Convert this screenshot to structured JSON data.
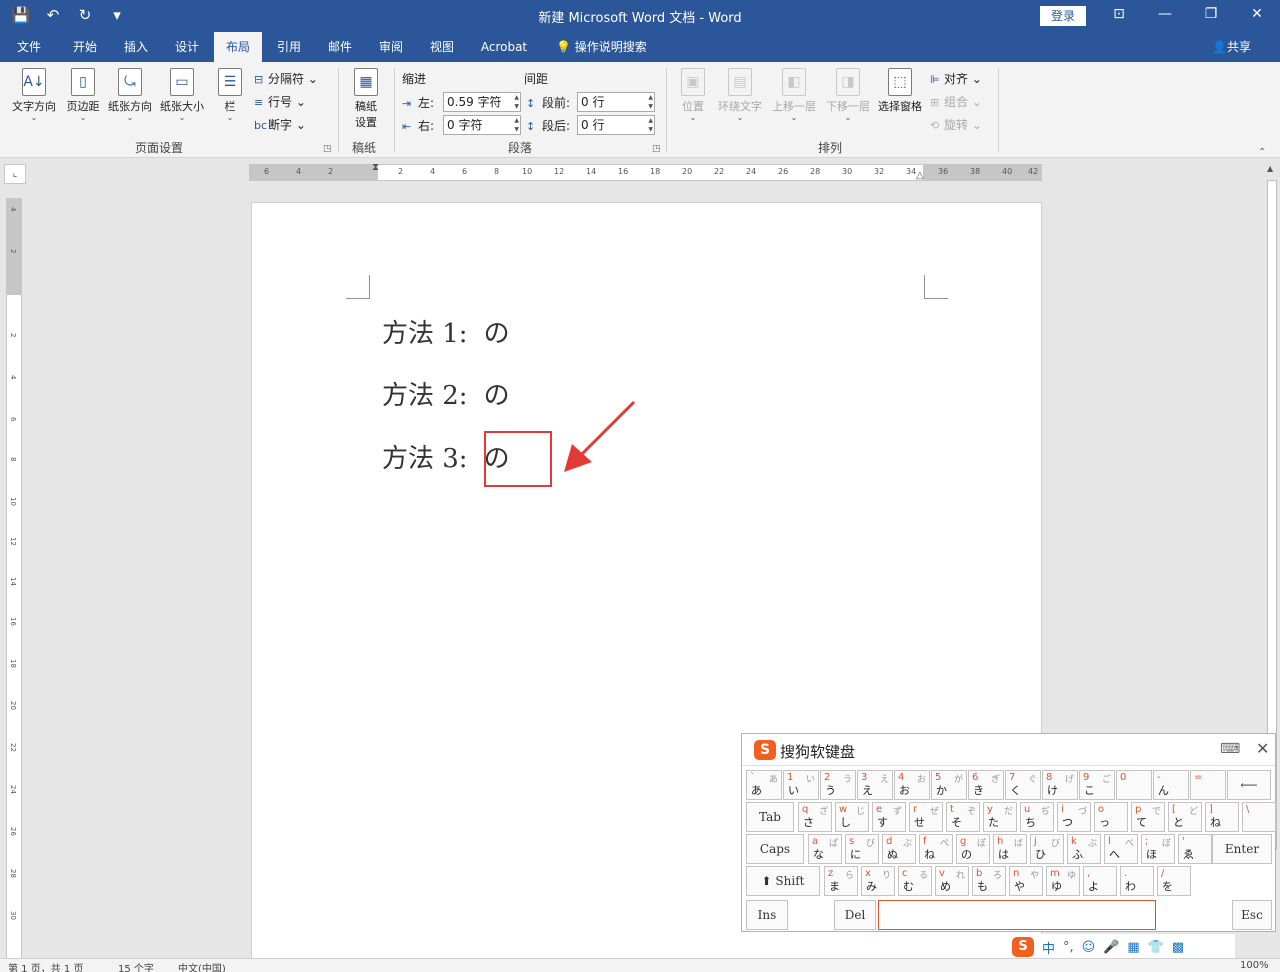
{
  "titlebar": {
    "title": "新建 Microsoft Word 文档 - Word",
    "login": "登录",
    "qat": [
      "💾",
      "↶",
      "↻",
      "▾"
    ]
  },
  "tabs": [
    "文件",
    "开始",
    "插入",
    "设计",
    "布局",
    "引用",
    "邮件",
    "审阅",
    "视图",
    "Acrobat"
  ],
  "tab_search": "操作说明搜索",
  "share": "共享",
  "ribbon": {
    "page_setup": {
      "text_direction": "文字方向",
      "margins": "页边距",
      "orientation": "纸张方向",
      "size": "纸张大小",
      "columns": "栏",
      "breaks": "分隔符",
      "line_numbers": "行号",
      "hyphenation": "断字",
      "group_label": "页面设置"
    },
    "manuscript": {
      "btn_line1": "稿纸",
      "btn_line2": "设置",
      "group_label": "稿纸"
    },
    "paragraph": {
      "indent_label": "缩进",
      "spacing_label": "间距",
      "left_label": "左:",
      "left_value": "0.59 字符",
      "right_label": "右:",
      "right_value": "0 字符",
      "before_label": "段前:",
      "before_value": "0 行",
      "after_label": "段后:",
      "after_value": "0 行",
      "group_label": "段落"
    },
    "arrange": {
      "position": "位置",
      "wrap_text": "环绕文字",
      "bring_forward": "上移一层",
      "send_backward": "下移一层",
      "selection_pane": "选择窗格",
      "align": "对齐",
      "group": "组合",
      "rotate": "旋转",
      "group_label": "排列"
    }
  },
  "ruler": {
    "h_ticks": [
      "6",
      "4",
      "2",
      "2",
      "4",
      "6",
      "8",
      "10",
      "12",
      "14",
      "16",
      "18",
      "20",
      "22",
      "24",
      "26",
      "28",
      "30",
      "32",
      "34",
      "36",
      "38",
      "40",
      "42"
    ],
    "v_ticks": [
      "4",
      "2",
      "2",
      "4",
      "6",
      "8",
      "10",
      "12",
      "14",
      "16",
      "18",
      "20",
      "22",
      "24",
      "26",
      "28",
      "30"
    ]
  },
  "document": {
    "lines": [
      {
        "label": "方法 1:",
        "char": "の"
      },
      {
        "label": "方法 2:",
        "char": "の"
      },
      {
        "label": "方法 3:",
        "char": "の"
      }
    ]
  },
  "keyboard": {
    "title": "搜狗软键盘",
    "row1": [
      {
        "tl": "`",
        "tr": "あ",
        "bl": "あ"
      },
      {
        "tl": "1",
        "tr": "い",
        "bl": "い"
      },
      {
        "tl": "2",
        "tr": "う",
        "bl": "う"
      },
      {
        "tl": "3",
        "tr": "え",
        "bl": "え"
      },
      {
        "tl": "4",
        "tr": "お",
        "bl": "お"
      },
      {
        "tl": "5",
        "tr": "が",
        "bl": "か"
      },
      {
        "tl": "6",
        "tr": "ぎ",
        "bl": "き"
      },
      {
        "tl": "7",
        "tr": "ぐ",
        "bl": "く"
      },
      {
        "tl": "8",
        "tr": "げ",
        "bl": "け"
      },
      {
        "tl": "9",
        "tr": "ご",
        "bl": "こ"
      },
      {
        "tl": "0",
        "tr": "",
        "bl": ""
      },
      {
        "tl": "-",
        "tr": "",
        "bl": "ん"
      },
      {
        "tl": "=",
        "tr": "",
        "bl": ""
      }
    ],
    "backspace": "⟵",
    "tab": "Tab",
    "row2": [
      {
        "tl": "q",
        "tr": "ざ",
        "bl": "さ"
      },
      {
        "tl": "w",
        "tr": "じ",
        "bl": "し"
      },
      {
        "tl": "e",
        "tr": "ず",
        "bl": "す"
      },
      {
        "tl": "r",
        "tr": "ぜ",
        "bl": "せ"
      },
      {
        "tl": "t",
        "tr": "ぞ",
        "bl": "そ"
      },
      {
        "tl": "y",
        "tr": "だ",
        "bl": "た"
      },
      {
        "tl": "u",
        "tr": "ぢ",
        "bl": "ち"
      },
      {
        "tl": "i",
        "tr": "づ",
        "bl": "つ"
      },
      {
        "tl": "o",
        "tr": "",
        "bl": "っ"
      },
      {
        "tl": "p",
        "tr": "で",
        "bl": "て"
      },
      {
        "tl": "[",
        "tr": "ど",
        "bl": "と"
      },
      {
        "tl": "]",
        "tr": "",
        "bl": "ね"
      },
      {
        "tl": "\\",
        "tr": "",
        "bl": ""
      }
    ],
    "caps": "Caps",
    "row3": [
      {
        "tl": "a",
        "tr": "ぱ",
        "bl": "な"
      },
      {
        "tl": "s",
        "tr": "び",
        "bl": "に"
      },
      {
        "tl": "d",
        "tr": "ぷ",
        "bl": "ぬ"
      },
      {
        "tl": "f",
        "tr": "ぺ",
        "bl": "ね"
      },
      {
        "tl": "g",
        "tr": "ぽ",
        "bl": "の"
      },
      {
        "tl": "h",
        "tr": "ば",
        "bl": "は"
      },
      {
        "tl": "j",
        "tr": "び",
        "bl": "ひ"
      },
      {
        "tl": "k",
        "tr": "ぶ",
        "bl": "ふ"
      },
      {
        "tl": "l",
        "tr": "べ",
        "bl": "へ"
      },
      {
        "tl": ";",
        "tr": "ぼ",
        "bl": "ほ"
      },
      {
        "tl": "'",
        "tr": "",
        "bl": "ゑ"
      }
    ],
    "enter": "Enter",
    "shift": "⬆ Shift",
    "row4": [
      {
        "tl": "z",
        "tr": "ら",
        "bl": "ま"
      },
      {
        "tl": "x",
        "tr": "り",
        "bl": "み"
      },
      {
        "tl": "c",
        "tr": "る",
        "bl": "む"
      },
      {
        "tl": "v",
        "tr": "れ",
        "bl": "め"
      },
      {
        "tl": "b",
        "tr": "ろ",
        "bl": "も"
      },
      {
        "tl": "n",
        "tr": "や",
        "bl": "や"
      },
      {
        "tl": "m",
        "tr": "ゆ",
        "bl": "ゆ"
      },
      {
        "tl": ",",
        "tr": "",
        "bl": "よ"
      },
      {
        "tl": ".",
        "tr": "",
        "bl": "わ"
      },
      {
        "tl": "/",
        "tr": "",
        "bl": "を"
      }
    ],
    "ins": "Ins",
    "del": "Del",
    "esc": "Esc"
  },
  "tray": [
    "中",
    "°,",
    "☺",
    "🎤",
    "▦",
    "👕",
    "▩"
  ],
  "statusbar": {
    "page": "第 1 页，共 1 页",
    "words": "15 个字",
    "lang": "中文(中国)",
    "zoom": "100%"
  },
  "colors": {
    "accent": "#2b579a",
    "highlight": "#e23a36",
    "sogou": "#f25f1f"
  }
}
